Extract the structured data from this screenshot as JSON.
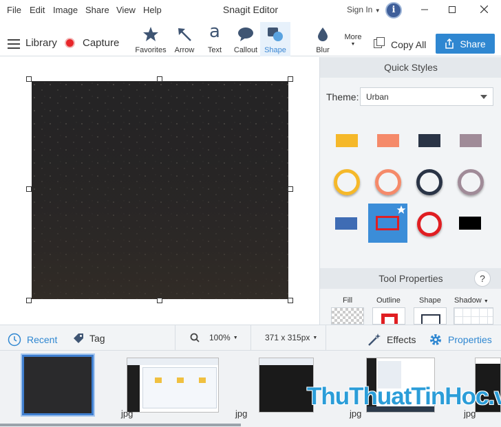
{
  "window": {
    "title": "Snagit Editor",
    "menu": [
      "File",
      "Edit",
      "Image",
      "Share",
      "View",
      "Help"
    ],
    "sign_in": "Sign In",
    "info_label": "i"
  },
  "toolbar": {
    "library": "Library",
    "capture": "Capture",
    "tools": [
      {
        "label": "Favorites",
        "icon": "star-icon"
      },
      {
        "label": "Arrow",
        "icon": "arrow-icon"
      },
      {
        "label": "Text",
        "icon": "text-icon",
        "glyph": "a"
      },
      {
        "label": "Callout",
        "icon": "callout-icon"
      },
      {
        "label": "Shape",
        "icon": "shape-icon",
        "selected": true
      },
      {
        "label": "Blur",
        "icon": "drop-icon"
      }
    ],
    "more": "More",
    "copy_all": "Copy All",
    "share": "Share"
  },
  "panel": {
    "quick_styles_title": "Quick Styles",
    "theme_label": "Theme:",
    "theme_value": "Urban",
    "swatch_colors": {
      "yellow": "#f5b82a",
      "orange": "#f58a6a",
      "navy": "#2a3446",
      "mauve": "#a08b98",
      "blue": "#3f6cb4",
      "red": "#e01e22",
      "black": "#000000",
      "selected_bg": "#3b8dd8"
    },
    "tool_properties_title": "Tool Properties",
    "help_label": "?",
    "properties": [
      "Fill",
      "Outline",
      "Shape",
      "Shadow"
    ]
  },
  "statusbar": {
    "recent": "Recent",
    "tag": "Tag",
    "zoom": "100%",
    "dimensions": "371 x 315px",
    "effects": "Effects",
    "properties": "Properties"
  },
  "tray": {
    "extensions": [
      "jpg",
      "jpg",
      "jpg",
      "jpg"
    ]
  },
  "watermark": "ThuThuatTinHoc.vn"
}
